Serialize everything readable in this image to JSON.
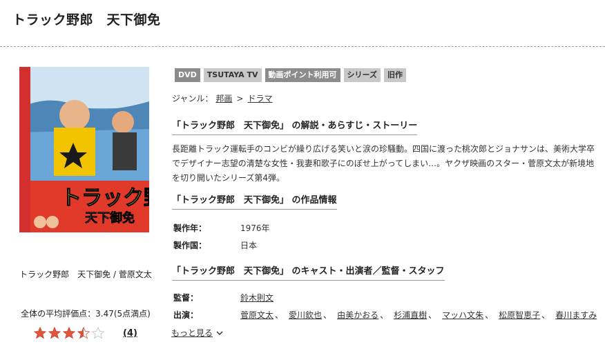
{
  "page_title": "トラック野郎　天下御免",
  "poster": {
    "alt_title": "トラック野郎",
    "alt_subtitle": "天下御免"
  },
  "caption": "トラック野郎　天下御免 / 菅原文太",
  "rating": {
    "label": "全体の平均評価点：3.47(5点満点)",
    "value": 3.47,
    "max": 5,
    "count": "(4)"
  },
  "tags": [
    "DVD",
    "TSUTAYA TV",
    "動画ポイント利用可",
    "シリーズ",
    "旧作"
  ],
  "genre": {
    "label": "ジャンル：",
    "items": [
      "邦画",
      "ドラマ"
    ],
    "separator": ">"
  },
  "synopsis_section": {
    "heading": "「トラック野郎　天下御免」 の解説・あらすじ・ストーリー",
    "text": "長距離トラック運転手のコンビが繰り広げる笑いと涙の珍騒動。四国に渡った桃次郎とジョナサンは、美術大学卒でデザイナー志望の清楚な女性・我妻和歌子にのぼせ上がってしまい…。ヤクザ映画のスター・菅原文太が新境地を切り開いたシリーズ第4弾。"
  },
  "info_section": {
    "heading": "「トラック野郎　天下御免」 の作品情報",
    "rows": [
      {
        "label": "製作年：",
        "value": "1976年"
      },
      {
        "label": "製作国：",
        "value": "日本"
      }
    ]
  },
  "cast_section": {
    "heading": "「トラック野郎　天下御免」 のキャスト・出演者／監督・スタッフ",
    "director_label": "監督：",
    "director": "鈴木則文",
    "cast_label": "出演：",
    "cast": [
      "菅原文太",
      "愛川欽也",
      "由美かおる",
      "杉浦直樹",
      "マッハ文朱",
      "松原智恵子",
      "春川ますみ"
    ],
    "more": "もっと見る"
  },
  "colors": {
    "star_fill": "#e0553c",
    "star_empty": "#cccccc",
    "tag_dark": "#8c8c8c",
    "tag_light": "#c8c8c8"
  }
}
